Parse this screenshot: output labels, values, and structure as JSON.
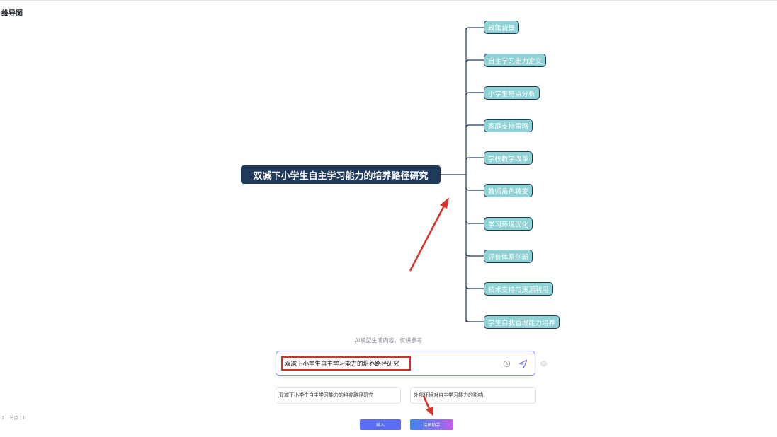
{
  "page": {
    "title": "维导图"
  },
  "status": {
    "left_num": "7",
    "nodes_text": "节点 11"
  },
  "mindmap": {
    "root": "双减下小学生自主学习能力的培养路径研究",
    "children": [
      "政策背景",
      "自主学习能力定义",
      "小学生特点分析",
      "家庭支持策略",
      "学校教学改革",
      "教师角色转变",
      "学习环境优化",
      "评价体系创新",
      "技术支持与资源利用",
      "学生自我管理能力培养"
    ]
  },
  "ai_panel": {
    "note": "AI模型生成内容，仅供参考",
    "input_value": "双减下小学生自主学习能力的培养路径研究",
    "suggestions": [
      "双减下小学生自主学习能力的培养路径研究",
      "外部环境对自主学习能力的影响"
    ],
    "insert_label": "插入",
    "helper_label": "绘图助手"
  },
  "colors": {
    "root_bg": "#1f3a5b",
    "child_bg": "#8fd2d6",
    "annotation": "#d0312d",
    "accent": "#5b6cf5"
  }
}
